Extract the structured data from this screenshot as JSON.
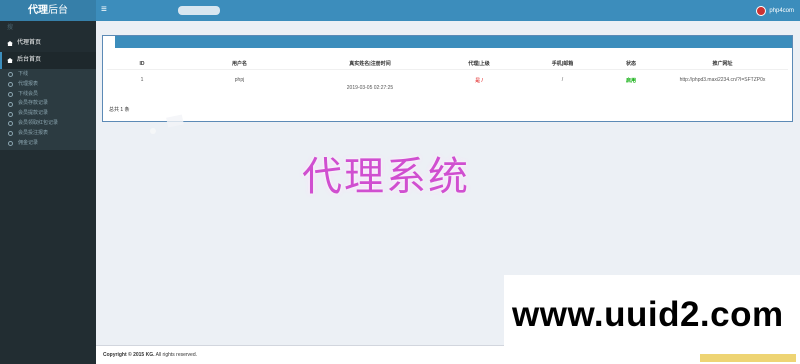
{
  "header": {
    "logo_bold": "代理",
    "logo_rest": "后台",
    "toggle_icon": "≡",
    "user_name": "php4com"
  },
  "sidebar": {
    "search_hint": "搜",
    "sections": [
      {
        "label": "代理首页",
        "icon": "home-icon"
      },
      {
        "label": "后台首页",
        "icon": "home-icon"
      }
    ],
    "sub_items": [
      "下线",
      "代理报表",
      "下线会员",
      "会员存款记录",
      "会员提款记录",
      "会员领取红包记录",
      "会员投注报表",
      "佣金记录"
    ]
  },
  "table": {
    "headers": [
      "ID",
      "用户名",
      "真实姓名|注册时间",
      "代理|上级",
      "手机|邮箱",
      "状态",
      "推广网址"
    ],
    "rows": [
      {
        "id": "1",
        "username": "phpj",
        "register_time": "2019-03-05 02:27:25",
        "agent_parent": "是 /",
        "contact": "/",
        "status": "启用",
        "promo_url": "http://phpd3.maxi2234.cn/?I=SFTZP0x"
      }
    ],
    "total": "总共 1 条"
  },
  "overlay_text": "代理系统",
  "watermark": "www.uuid2.com",
  "footer": {
    "copyright_bold": "Copyright © 2015 KG.",
    "copyright_rest": " All rights reserved."
  },
  "colors": {
    "header": "#3c8dbc",
    "sidebar": "#222d32",
    "overlay": "#d04fd0",
    "status_active": "#00aa00"
  }
}
